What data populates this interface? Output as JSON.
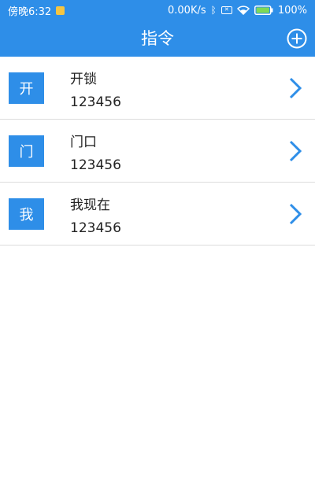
{
  "status_bar": {
    "time": "傍晚6:32",
    "network_speed": "0.00K/s",
    "battery_percent": "100%",
    "icons": [
      "notification-icon",
      "bluetooth-icon",
      "sim-icon",
      "wifi-icon",
      "battery-icon"
    ]
  },
  "app_bar": {
    "title": "指令",
    "add_icon": "plus-circle-icon"
  },
  "commands": [
    {
      "avatar": "开",
      "title": "开锁",
      "code": "123456"
    },
    {
      "avatar": "门",
      "title": "门口",
      "code": "123456"
    },
    {
      "avatar": "我",
      "title": "我现在",
      "code": "123456"
    }
  ],
  "colors": {
    "primary": "#2e8ee8",
    "divider": "#dcdcdc",
    "text": "#222222"
  }
}
